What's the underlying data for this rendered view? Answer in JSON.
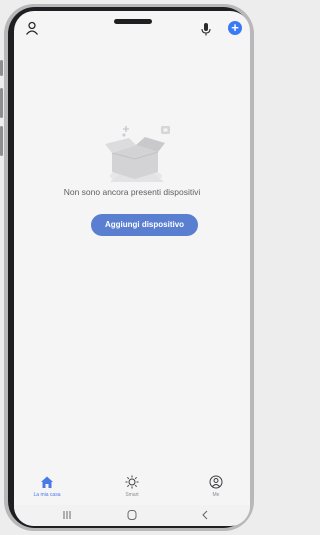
{
  "empty_state": {
    "message": "Non sono ancora presenti dispositivi",
    "button_label": "Aggiungi dispositivo"
  },
  "tabs": [
    {
      "label": "La mia casa",
      "icon": "home-icon",
      "active": true
    },
    {
      "label": "Smart",
      "icon": "sun-icon",
      "active": false
    },
    {
      "label": "Me",
      "icon": "user-icon",
      "active": false
    }
  ],
  "system_nav": [
    "recents-icon",
    "home-circle-icon",
    "back-icon"
  ],
  "colors": {
    "accent": "#5a7fd1",
    "add_icon": "#3a7bf5",
    "active_tab": "#4a78e6"
  }
}
